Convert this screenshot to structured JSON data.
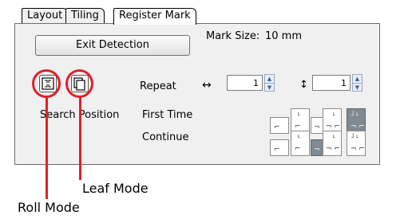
{
  "tabs": [
    {
      "label": "Layout",
      "active": false
    },
    {
      "label": "Tiling",
      "active": false
    },
    {
      "label": "Register Mark",
      "active": true
    }
  ],
  "exit_detection_label": "Exit Detection",
  "mark_size_label": "Mark Size:",
  "mark_size_value": "10 mm",
  "repeat_label": "Repeat",
  "horizontal_icon": "↔",
  "vertical_icon": "↕",
  "repeat_horizontal_value": "1",
  "repeat_vertical_value": "1",
  "search_position_label": "Search Position",
  "first_time_label": "First Time",
  "continue_label": "Continue",
  "callouts": {
    "roll_mode": "Roll Mode",
    "leaf_mode": "Leaf Mode"
  },
  "colors": {
    "callout": "#e0202a",
    "selected_cell": "#7f8a92"
  },
  "first_time_selected_index": 4,
  "continue_selected_index": 2
}
